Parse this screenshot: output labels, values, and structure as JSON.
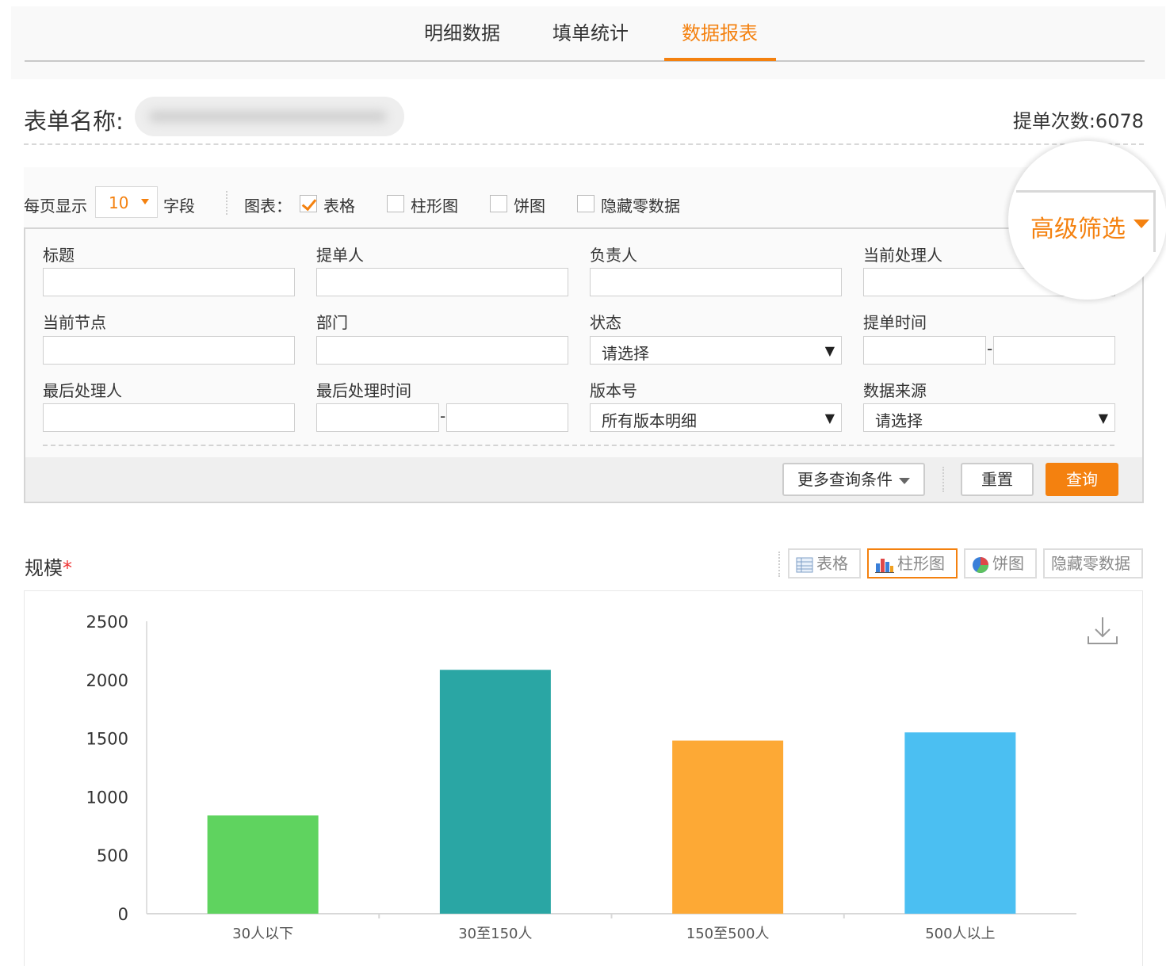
{
  "tabs": [
    {
      "label": "明细数据",
      "active": false
    },
    {
      "label": "填单统计",
      "active": false
    },
    {
      "label": "数据报表",
      "active": true
    }
  ],
  "form": {
    "name_label": "表单名称:",
    "submit_count_label": "提单次数:",
    "submit_count": "6078"
  },
  "options": {
    "per_page_label": "每页显示",
    "per_page_value": "10",
    "fields_label": "字段",
    "chart_label": "图表：",
    "checkboxes": [
      {
        "label": "表格",
        "checked": true
      },
      {
        "label": "柱形图",
        "checked": false
      },
      {
        "label": "饼图",
        "checked": false
      },
      {
        "label": "隐藏零数据",
        "checked": false
      }
    ]
  },
  "advanced_filter_label": "高级筛选",
  "filters": {
    "title": "标题",
    "submitter": "提单人",
    "owner": "负责人",
    "current_handler": "当前处理人",
    "current_node": "当前节点",
    "department": "部门",
    "status": "状态",
    "status_value": "请选择",
    "submit_time": "提单时间",
    "last_handler": "最后处理人",
    "last_handle_time": "最后处理时间",
    "version": "版本号",
    "version_value": "所有版本明细",
    "data_source": "数据来源",
    "data_source_value": "请选择",
    "range_sep": "-"
  },
  "buttons": {
    "more_conditions": "更多查询条件",
    "reset": "重置",
    "query": "查询"
  },
  "section": {
    "title": "规模",
    "required_mark": "*"
  },
  "chart_toggles": [
    {
      "label": "表格",
      "icon": "table-icon",
      "active": false
    },
    {
      "label": "柱形图",
      "icon": "bar-chart-icon",
      "active": true
    },
    {
      "label": "饼图",
      "icon": "pie-chart-icon",
      "active": false
    },
    {
      "label": "隐藏零数据",
      "icon": "",
      "active": false
    }
  ],
  "colors": {
    "accent": "#f4810f",
    "bars": [
      "#5fd35f",
      "#2aa6a4",
      "#fda935",
      "#4bbff2"
    ]
  },
  "chart_data": {
    "type": "bar",
    "categories": [
      "30人以下",
      "30至150人",
      "150至500人",
      "500人以上"
    ],
    "values": [
      840,
      2085,
      1480,
      1550
    ],
    "ylim": [
      0,
      2500
    ],
    "yticks": [
      0,
      500,
      1000,
      1500,
      2000,
      2500
    ],
    "grid": false,
    "legend": "none"
  }
}
